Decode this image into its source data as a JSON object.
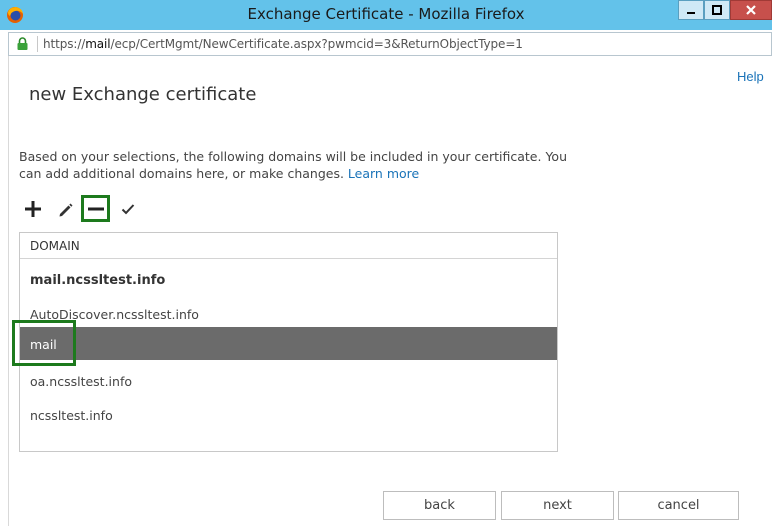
{
  "window": {
    "title": "Exchange Certificate - Mozilla Firefox"
  },
  "urlbar": {
    "prefix": "https://",
    "host": "mail",
    "path": "/ecp/CertMgmt/NewCertificate.aspx?pwmcid=3&ReturnObjectType=1"
  },
  "page": {
    "help": "Help",
    "title": "new Exchange certificate",
    "description": "Based on your selections, the following domains will be included in your certificate. You can add additional domains here, or make changes. ",
    "learn_more": "Learn more"
  },
  "toolbar": {
    "add_icon": "plus-icon",
    "edit_icon": "pencil-icon",
    "remove_icon": "minus-icon",
    "set_default_icon": "check-icon"
  },
  "domains": {
    "header": "DOMAIN",
    "rows": [
      {
        "label": "mail.ncssltest.info",
        "bold": true
      },
      {
        "label": "AutoDiscover.ncssltest.info"
      },
      {
        "label": "mail",
        "selected": true
      },
      {
        "label": "oa.ncssltest.info"
      },
      {
        "label": "ncssltest.info"
      }
    ]
  },
  "buttons": {
    "back": "back",
    "next": "next",
    "cancel": "cancel"
  },
  "colors": {
    "titlebar": "#63c2ea",
    "link": "#1a73b8",
    "selected_row": "#6b6b6b",
    "highlight_box": "#1d7a1d",
    "close_button": "#c7504c"
  }
}
